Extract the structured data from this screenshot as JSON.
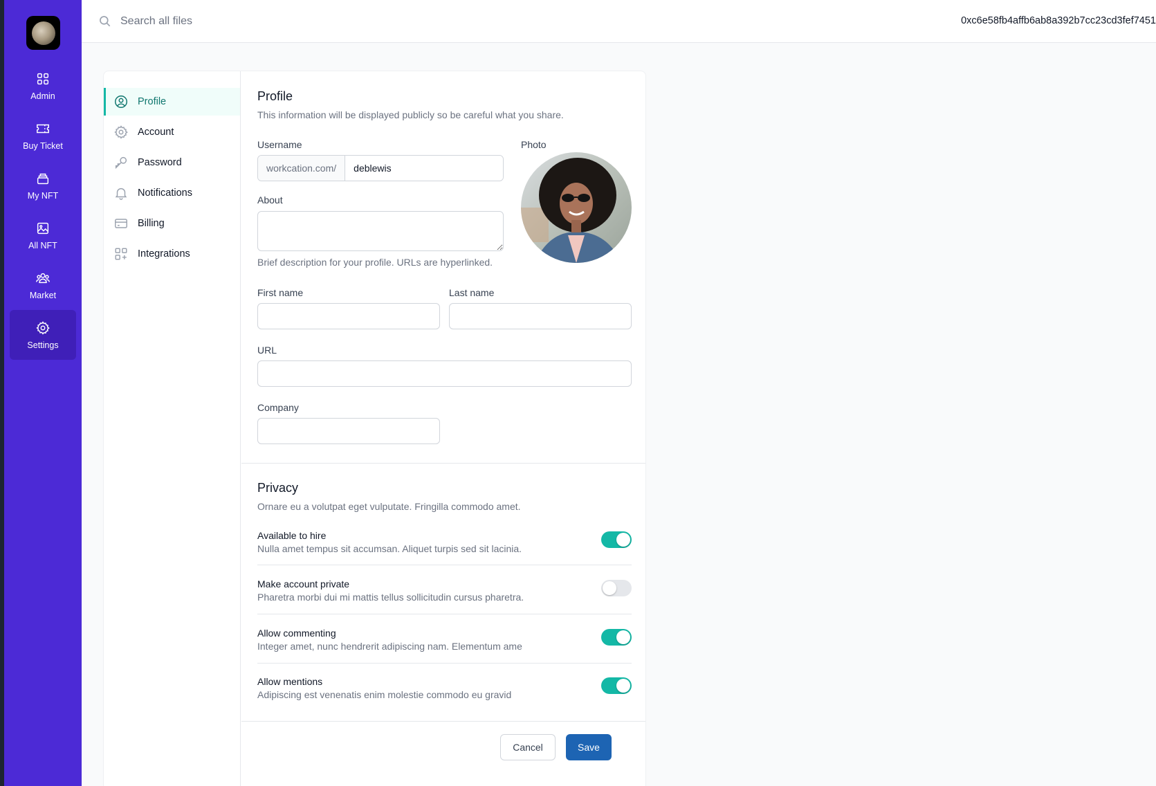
{
  "sidebar": {
    "items": [
      {
        "label": "Admin",
        "icon": "grid-icon"
      },
      {
        "label": "Buy Ticket",
        "icon": "ticket-icon"
      },
      {
        "label": "My NFT",
        "icon": "stack-icon"
      },
      {
        "label": "All NFT",
        "icon": "image-icon"
      },
      {
        "label": "Market",
        "icon": "users-icon"
      },
      {
        "label": "Settings",
        "icon": "gear-icon",
        "active": true
      }
    ],
    "bg_color": "#4c2ad6"
  },
  "topbar": {
    "search_placeholder": "Search all files",
    "wallet_address": "0xc6e58fb4affb6ab8a392b7cc23cd3fef7451"
  },
  "settings_nav": {
    "items": [
      {
        "label": "Profile",
        "icon": "user-circle-icon"
      },
      {
        "label": "Account",
        "icon": "gear-icon"
      },
      {
        "label": "Password",
        "icon": "key-icon"
      },
      {
        "label": "Notifications",
        "icon": "bell-icon"
      },
      {
        "label": "Billing",
        "icon": "credit-card-icon"
      },
      {
        "label": "Integrations",
        "icon": "squares-plus-icon"
      }
    ],
    "active_color": "#14b8a6"
  },
  "profile": {
    "title": "Profile",
    "description": "This information will be displayed publicly so be careful what you share.",
    "username_label": "Username",
    "username_prefix": "workcation.com/",
    "username_value": "deblewis",
    "photo_label": "Photo",
    "about_label": "About",
    "about_help": "Brief description for your profile. URLs are hyperlinked.",
    "first_name_label": "First name",
    "last_name_label": "Last name",
    "url_label": "URL",
    "company_label": "Company"
  },
  "privacy": {
    "title": "Privacy",
    "description": "Ornare eu a volutpat eget vulputate. Fringilla commodo amet.",
    "toggles": [
      {
        "title": "Available to hire",
        "desc": "Nulla amet tempus sit accumsan. Aliquet turpis sed sit lacinia.",
        "on": true
      },
      {
        "title": "Make account private",
        "desc": "Pharetra morbi dui mi mattis tellus sollicitudin cursus pharetra.",
        "on": false
      },
      {
        "title": "Allow commenting",
        "desc": "Integer amet, nunc hendrerit adipiscing nam. Elementum ame",
        "on": true
      },
      {
        "title": "Allow mentions",
        "desc": "Adipiscing est venenatis enim molestie commodo eu gravid",
        "on": true
      }
    ]
  },
  "actions": {
    "cancel_label": "Cancel",
    "save_label": "Save",
    "save_color": "#1d64b3"
  }
}
